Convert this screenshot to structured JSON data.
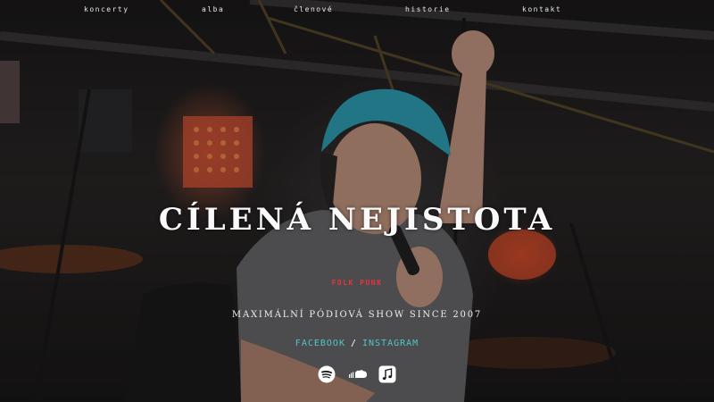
{
  "nav": {
    "items": [
      {
        "label": "koncerty"
      },
      {
        "label": "alba"
      },
      {
        "label": "členové"
      },
      {
        "label": "historie"
      },
      {
        "label": "kontakt"
      }
    ]
  },
  "hero": {
    "title": "CÍLENÁ NEJISTOTA",
    "genre": "FOLK PUNK",
    "tagline": "MAXIMÁLNÍ PÓDIOVÁ SHOW SINCE 2007",
    "social_links": {
      "facebook": "FACEBOOK",
      "separator": "/",
      "instagram": "INSTAGRAM"
    },
    "streaming_icons": [
      "spotify-icon",
      "soundcloud-icon",
      "apple-music-icon"
    ]
  },
  "colors": {
    "title": "#fafafa",
    "genre": "#e8343a",
    "social_link": "#4fc7c6",
    "background": "#1c1a1b"
  }
}
